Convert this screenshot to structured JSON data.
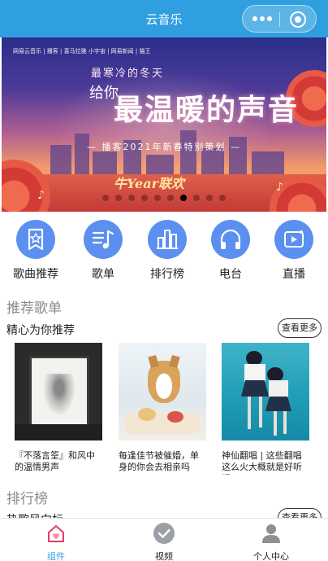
{
  "navbar": {
    "title": "云音乐"
  },
  "banner": {
    "logos": "网易云音乐 | 播客 | 喜马拉雅 小宇宙 | 网易新闻 | 猫王",
    "headline": "最寒冷的冬天",
    "slogan_small": "给你",
    "slogan_big": "最温暖的声音",
    "subline": "— 播客2021年新春特别策划 —",
    "year_text": "牛Year联欢",
    "slide_count": 10,
    "active_slide": 7
  },
  "categories": [
    {
      "label": "歌曲推荐",
      "icon": "bookmark-star-icon"
    },
    {
      "label": "歌单",
      "icon": "music-list-icon"
    },
    {
      "label": "排行榜",
      "icon": "bar-chart-icon"
    },
    {
      "label": "电台",
      "icon": "headphones-icon"
    },
    {
      "label": "直播",
      "icon": "live-video-icon"
    }
  ],
  "recommend": {
    "section_title": "推荐歌单",
    "sub_title": "精心为你推荐",
    "more_label": "查看更多",
    "playlists": [
      {
        "caption": "『不落言筌』和风中的温情男声"
      },
      {
        "caption": "每逢佳节被催婚，单身的你会去相亲吗"
      },
      {
        "caption": "神仙翻唱 | 这些翻唱这么火大概就是好听吧"
      }
    ]
  },
  "ranking": {
    "section_title": "排行榜",
    "sub_title": "热歌风向标",
    "more_label": "查看更多"
  },
  "tabbar": {
    "items": [
      {
        "label": "组件",
        "icon": "home-heart-icon",
        "active": true
      },
      {
        "label": "视频",
        "icon": "check-circle-icon",
        "active": false
      },
      {
        "label": "个人中心",
        "icon": "user-icon",
        "active": false
      }
    ]
  },
  "colors": {
    "navbar": "#2f9fe0",
    "icon_circle": "#5b8ff0",
    "tab_active": "#2f9fe0"
  }
}
